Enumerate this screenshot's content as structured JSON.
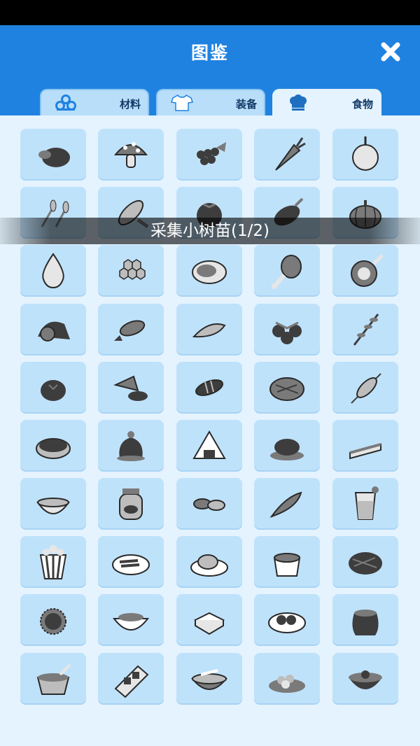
{
  "header": {
    "title": "图鉴",
    "background_color": "#1f82e0"
  },
  "tabs": [
    {
      "label": "材料",
      "icon": "materials-icon",
      "active": false
    },
    {
      "label": "装备",
      "icon": "shirt-icon",
      "active": false
    },
    {
      "label": "食物",
      "icon": "chef-hat-icon",
      "active": true
    }
  ],
  "toast": {
    "text": "采集小树苗(1/2)"
  },
  "grid": {
    "items": [
      "truffle-icon",
      "mushroom-icon",
      "grapes-icon",
      "carrot-icon",
      "onion-icon",
      "wheat-icon",
      "corn-icon",
      "tomato-icon",
      "eggplant-icon",
      "pumpkin-icon",
      "droplet-icon",
      "honeycomb-icon",
      "steak-icon",
      "drumstick-icon",
      "ham-icon",
      "ham-hock-icon",
      "fish-icon",
      "shrimp-icon",
      "berries-icon",
      "herb-sprig-icon",
      "egg-icon",
      "cooked-meat-icon",
      "grilled-fish-icon",
      "pie-crust-icon",
      "skewer-icon",
      "bean-bowl-icon",
      "sack-dish-icon",
      "rice-ball-icon",
      "roast-dish-icon",
      "cake-slice-icon",
      "soup-bowl-icon",
      "jar-icon",
      "dumplings-icon",
      "smoked-fish-icon",
      "juice-icon",
      "popcorn-icon",
      "bacon-plate-icon",
      "roast-chicken-icon",
      "stew-cup-icon",
      "grilled-steak-icon",
      "durian-icon",
      "fish-soup-icon",
      "tofu-icon",
      "meatball-plate-icon",
      "pot-icon",
      "bone-stew-icon",
      "sushi-icon",
      "bone-bowl-icon",
      "salad-plate-icon",
      "dark-bowl-icon"
    ]
  }
}
